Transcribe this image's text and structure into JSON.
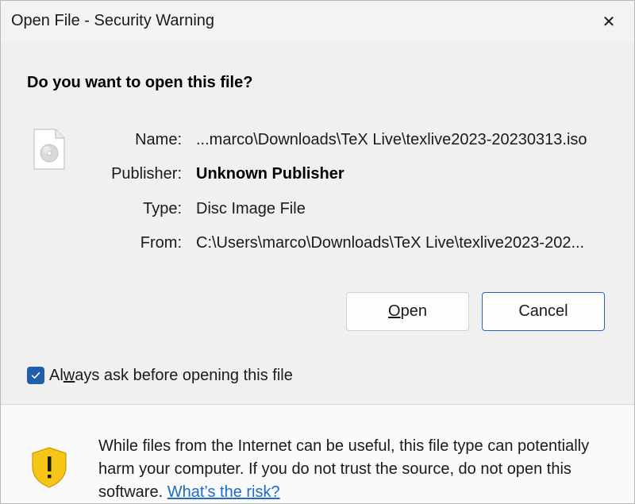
{
  "window": {
    "title": "Open File - Security Warning",
    "close_glyph": "✕"
  },
  "dialog": {
    "heading": "Do you want to open this file?",
    "file_icon": "disc-image-file-icon",
    "rows": {
      "name": {
        "label": "Name:",
        "value": "...marco\\Downloads\\TeX Live\\texlive2023-20230313.iso"
      },
      "publisher": {
        "label": "Publisher:",
        "value": "Unknown Publisher"
      },
      "type": {
        "label": "Type:",
        "value": "Disc Image File"
      },
      "from": {
        "label": "From:",
        "value": "C:\\Users\\marco\\Downloads\\TeX Live\\texlive2023-202..."
      }
    },
    "buttons": {
      "open": {
        "before": "",
        "accel": "O",
        "after": "pen"
      },
      "cancel": {
        "label": "Cancel"
      }
    },
    "checkbox": {
      "checked": true,
      "label_before": "Al",
      "label_accel": "w",
      "label_after": "ays ask before opening this file"
    }
  },
  "footer": {
    "icon": "warning-shield-icon",
    "message": "While files from the Internet can be useful, this file type can potentially harm your computer. If you do not trust the source, do not open this software.",
    "link": "What’s the risk?"
  },
  "colors": {
    "accent": "#1f5fab",
    "link": "#1d6ac7",
    "shield_yellow": "#f5c518"
  }
}
